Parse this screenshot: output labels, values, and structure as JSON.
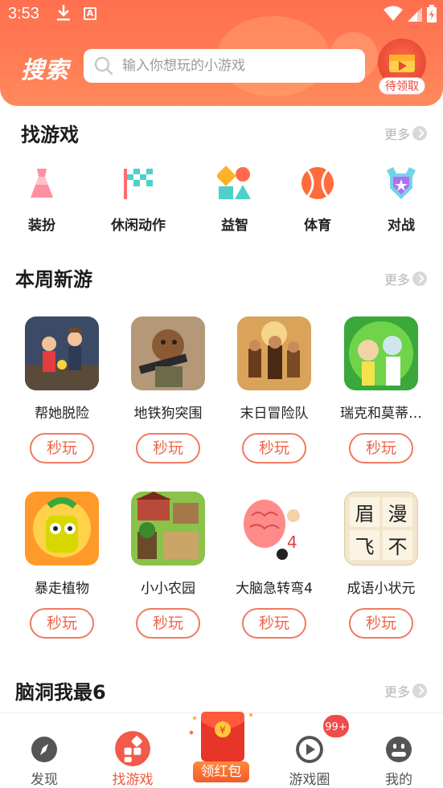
{
  "status": {
    "time": "3:53"
  },
  "header": {
    "title": "搜索",
    "search_placeholder": "输入你想玩的小游戏",
    "gift_label": "待领取"
  },
  "find_games": {
    "title": "找游戏",
    "more": "更多",
    "categories": [
      {
        "label": "装扮",
        "icon": "dress-icon"
      },
      {
        "label": "休闲动作",
        "icon": "flag-icon"
      },
      {
        "label": "益智",
        "icon": "shapes-icon"
      },
      {
        "label": "体育",
        "icon": "ball-icon"
      },
      {
        "label": "对战",
        "icon": "shield-icon"
      }
    ]
  },
  "weekly_new": {
    "title": "本周新游",
    "more": "更多",
    "play_label": "秒玩",
    "games": [
      {
        "name": "帮她脱险"
      },
      {
        "name": "地铁狗突围"
      },
      {
        "name": "末日冒险队"
      },
      {
        "name": "瑞克和莫蒂…"
      },
      {
        "name": "暴走植物"
      },
      {
        "name": "小小农园"
      },
      {
        "name": "大脑急转弯4"
      },
      {
        "name": "成语小状元"
      }
    ],
    "idiom_chars": [
      "眉",
      "漫",
      "飞",
      "不"
    ]
  },
  "brain_hole": {
    "title": "脑洞我最6",
    "more": "更多"
  },
  "bottom_nav": {
    "items": [
      {
        "label": "发现",
        "icon": "compass-icon"
      },
      {
        "label": "找游戏",
        "icon": "game-grid-icon"
      },
      {
        "label": "领红包",
        "icon": "red-packet-icon"
      },
      {
        "label": "游戏圈",
        "icon": "play-circle-icon"
      },
      {
        "label": "我的",
        "icon": "face-icon"
      }
    ],
    "badge": "99+",
    "red_packet_symbol": "¥"
  },
  "colors": {
    "accent": "#f05a3c",
    "header": "#ff7452"
  }
}
